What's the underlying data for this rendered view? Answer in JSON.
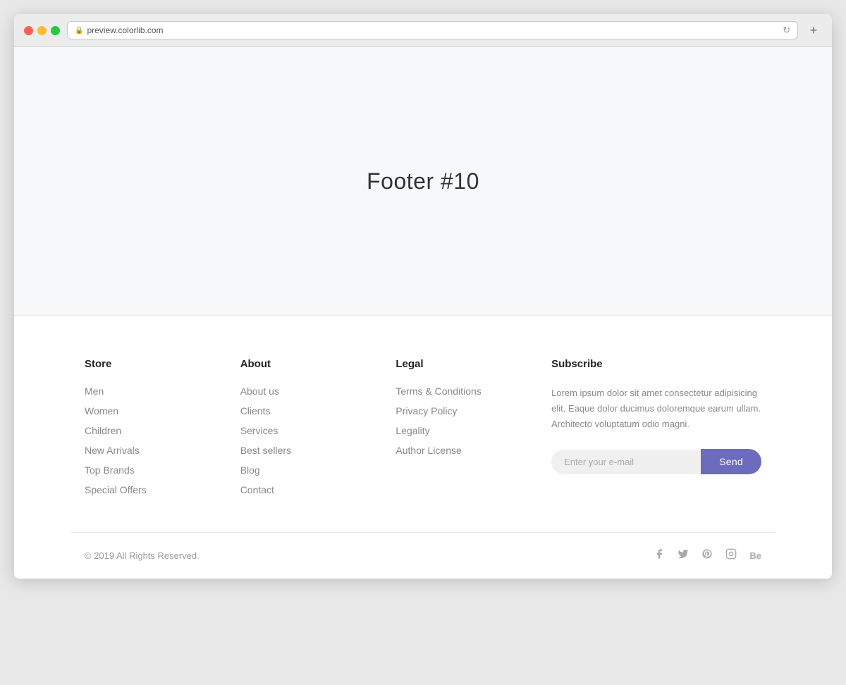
{
  "browser": {
    "url": "preview.colorlib.com",
    "new_tab_label": "+"
  },
  "hero": {
    "title": "Footer #10"
  },
  "footer": {
    "columns": [
      {
        "id": "store",
        "title": "Store",
        "links": [
          "Men",
          "Women",
          "Children",
          "New Arrivals",
          "Top Brands",
          "Special Offers"
        ]
      },
      {
        "id": "about",
        "title": "About",
        "links": [
          "About us",
          "Clients",
          "Services",
          "Best sellers",
          "Blog",
          "Contact"
        ]
      },
      {
        "id": "legal",
        "title": "Legal",
        "links": [
          "Terms & Conditions",
          "Privacy Policy",
          "Legality",
          "Author License"
        ]
      },
      {
        "id": "subscribe",
        "title": "Subscribe",
        "description": "Lorem ipsum dolor sit amet consectetur adipisicing elit. Eaque dolor ducimus doloremque earum ullam. Architecto voluptatum odio magni.",
        "email_placeholder": "Enter your e-mail",
        "send_label": "Send"
      }
    ],
    "bottom": {
      "copyright": "© 2019 All Rights Reserved.",
      "social_icons": [
        {
          "name": "facebook",
          "symbol": "f"
        },
        {
          "name": "twitter",
          "symbol": "t"
        },
        {
          "name": "pinterest",
          "symbol": "p"
        },
        {
          "name": "instagram",
          "symbol": "i"
        },
        {
          "name": "behance",
          "symbol": "Be"
        }
      ]
    }
  }
}
